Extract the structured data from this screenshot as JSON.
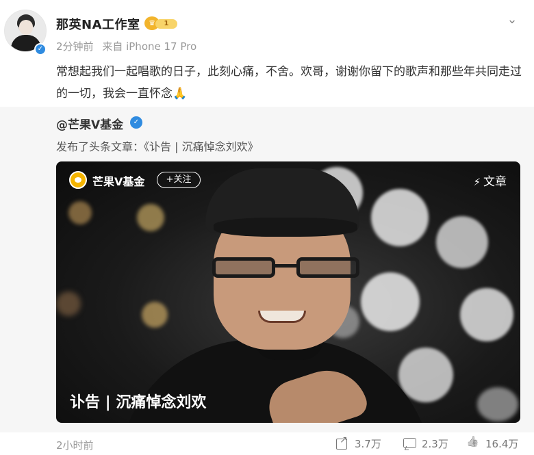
{
  "post": {
    "author": {
      "name": "那英NA工作室",
      "badge_level": "1",
      "avatar_icon": "avatar-photo",
      "verified_icon": "verified-icon"
    },
    "meta": {
      "time": "2分钟前",
      "source": "来自 iPhone 17 Pro"
    },
    "text": "常想起我们一起唱歌的日子，此刻心痛，不舍。欢哥，谢谢你留下的歌声和那些年共同走过的一切，我会一直怀念🙏",
    "menu_icon": "chevron-down-icon"
  },
  "repost": {
    "user": "@芒果V基金",
    "action": "发布了头条文章：《讣告 | 沉痛悼念刘欢》",
    "card": {
      "account_name": "芒果V基金",
      "follow_label": "+关注",
      "type_label": "文章",
      "caption": "讣告 | 沉痛悼念刘欢"
    }
  },
  "footer": {
    "time": "2小时前",
    "shares": "3.7万",
    "comments": "2.3万",
    "likes": "16.4万"
  },
  "colors": {
    "verified": "#2f8be0",
    "vip_gold": "#f2b42c",
    "repost_bg": "#f6f6f6"
  }
}
